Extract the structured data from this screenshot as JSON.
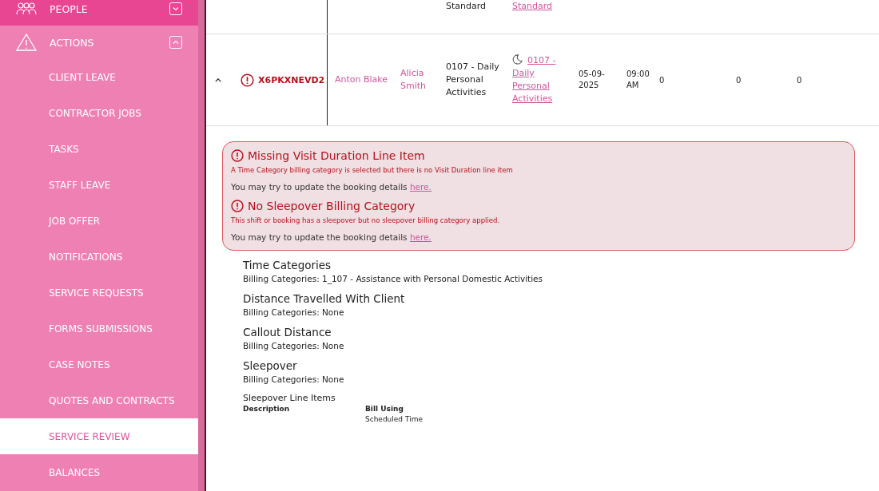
{
  "sidebar": {
    "items": [
      {
        "kind": "section",
        "label": "PEOPLE",
        "expanded": false,
        "active": true
      },
      {
        "kind": "section",
        "label": "ACTIONS",
        "expanded": true,
        "active": false
      },
      {
        "kind": "sub",
        "label": "CLIENT LEAVE",
        "selected": false
      },
      {
        "kind": "sub",
        "label": "CONTRACTOR JOBS",
        "selected": false
      },
      {
        "kind": "sub",
        "label": "TASKS",
        "selected": false
      },
      {
        "kind": "sub",
        "label": "STAFF LEAVE",
        "selected": false
      },
      {
        "kind": "sub",
        "label": "JOB OFFER",
        "selected": false
      },
      {
        "kind": "sub",
        "label": "NOTIFICATIONS",
        "selected": false
      },
      {
        "kind": "sub",
        "label": "SERVICE REQUESTS",
        "selected": false
      },
      {
        "kind": "sub",
        "label": "FORMS SUBMISSIONS",
        "selected": false
      },
      {
        "kind": "sub",
        "label": "CASE NOTES",
        "selected": false
      },
      {
        "kind": "sub",
        "label": "QUOTES AND CONTRACTS",
        "selected": false
      },
      {
        "kind": "sub",
        "label": "SERVICE REVIEW",
        "selected": true
      },
      {
        "kind": "sub",
        "label": "BALANCES",
        "selected": false
      }
    ]
  },
  "table": {
    "partial_row": {
      "service": "Standard",
      "service_link": "Standard"
    },
    "rows": [
      {
        "expanded": true,
        "id": "X6PKXNEVD2",
        "staff": "Anton Blake",
        "client": "Alicia Smith",
        "service": "0107 - Daily Personal Activities",
        "service_link": "0107 - Daily Personal Activities",
        "date": "05-09-2025",
        "time": "09:00 AM",
        "column_9": "0",
        "column_10": "0",
        "column_11": "0"
      }
    ]
  },
  "issues": [
    {
      "title": "Missing Visit Duration Line Item",
      "detail": "A Time Category billing category is selected but there is no Visit Duration line item",
      "prompt": "You may try to update the booking details",
      "link": "here."
    },
    {
      "title": "No Sleepover Billing Category",
      "detail": "This shift or booking has a sleepover but no sleepover billing category applied.",
      "prompt": "You may try to update the booking details",
      "link": "here."
    }
  ],
  "categories": [
    {
      "title": "Time Categories",
      "value": "Billing Categories: 1_107 - Assistance with Personal Domestic Activities"
    },
    {
      "title": "Distance Travelled With Client",
      "value": "Billing Categories: None"
    },
    {
      "title": "Callout Distance",
      "value": "Billing Categories: None"
    },
    {
      "title": "Sleepover",
      "value": "Billing Categories: None"
    }
  ],
  "line_items": {
    "title": "Sleepover Line Items",
    "columns": [
      "Description",
      "Bill Using"
    ],
    "rows": [
      [
        "",
        "Scheduled Time"
      ]
    ]
  }
}
